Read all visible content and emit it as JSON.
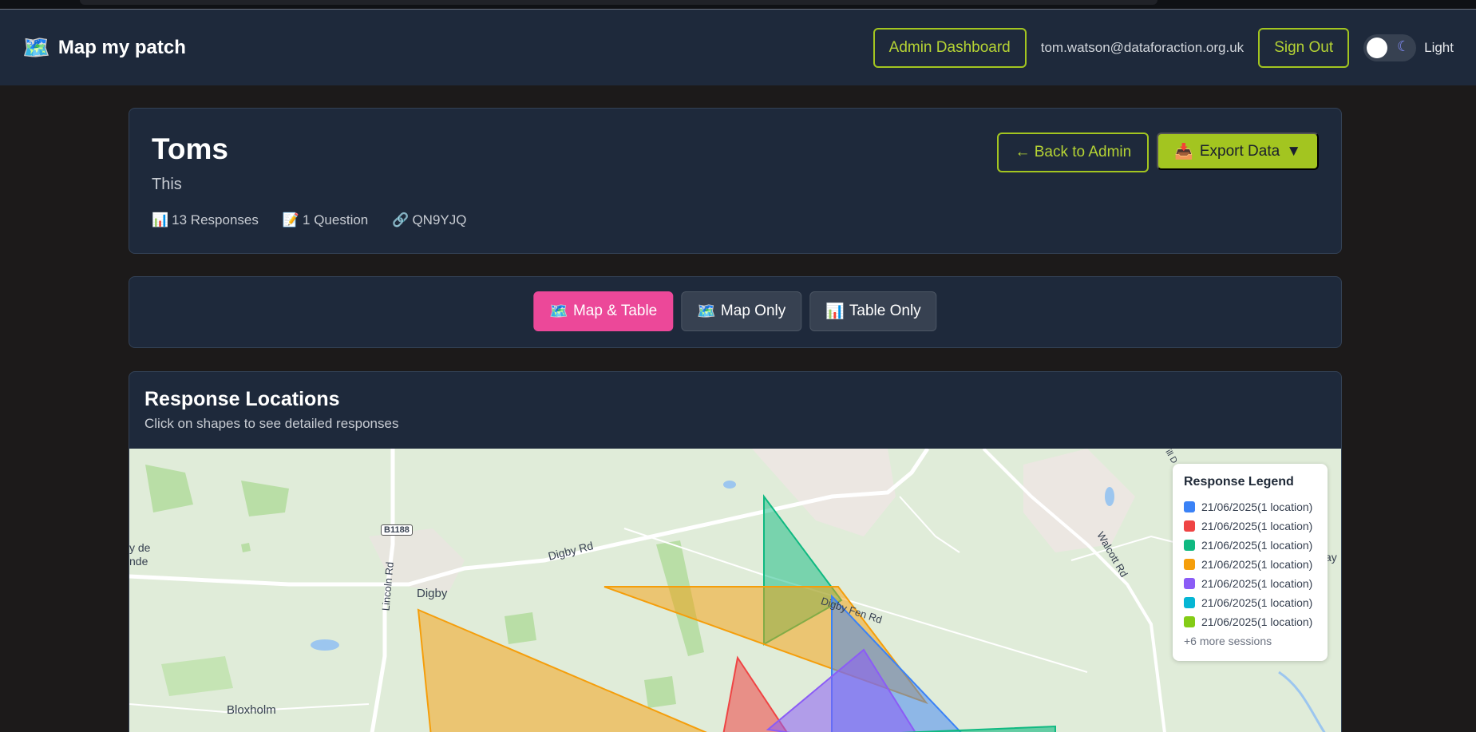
{
  "nav": {
    "logo_icon": "🗺️",
    "app_title": "Map my patch",
    "admin_dashboard_label": "Admin Dashboard",
    "user_email": "tom.watson@dataforaction.org.uk",
    "sign_out_label": "Sign Out",
    "theme_icon": "☾",
    "theme_label": "Light"
  },
  "survey": {
    "title": "Toms",
    "description": "This",
    "stats": [
      {
        "icon": "📊",
        "label": "13 Responses"
      },
      {
        "icon": "📝",
        "label": "1 Question"
      },
      {
        "icon": "🔗",
        "label": "QN9YJQ"
      }
    ],
    "back_label": "← Back to Admin",
    "export_icon": "📥",
    "export_label": "Export Data",
    "export_caret": "▼"
  },
  "view_modes": [
    {
      "icon": "🗺️",
      "label": "Map & Table",
      "active": true
    },
    {
      "icon": "🗺️",
      "label": "Map Only",
      "active": false
    },
    {
      "icon": "📊",
      "label": "Table Only",
      "active": false
    }
  ],
  "map": {
    "title": "Response Locations",
    "subtitle": "Click on shapes to see detailed responses",
    "place_labels": {
      "digby": "Digby",
      "digby_rd": "Digby Rd",
      "digby_fen_rd": "Digby Fen Rd",
      "lincoln_rd": "Lincoln Rd",
      "walcott_rd": "Walcott Rd",
      "bloxholm": "Bloxholm",
      "b1188": "B1188",
      "edge_left_1": "y de",
      "edge_left_2": "nde",
      "edge_right": "ay",
      "edge_top": "ill D"
    },
    "legend": {
      "title": "Response Legend",
      "items": [
        {
          "label": "21/06/2025(1 location)",
          "color": "#3b82f6"
        },
        {
          "label": "21/06/2025(1 location)",
          "color": "#ef4444"
        },
        {
          "label": "21/06/2025(1 location)",
          "color": "#10b981"
        },
        {
          "label": "21/06/2025(1 location)",
          "color": "#f59e0b"
        },
        {
          "label": "21/06/2025(1 location)",
          "color": "#8b5cf6"
        },
        {
          "label": "21/06/2025(1 location)",
          "color": "#06b6d4"
        },
        {
          "label": "21/06/2025(1 location)",
          "color": "#84cc16"
        }
      ],
      "more_label": "+6 more sessions"
    }
  }
}
